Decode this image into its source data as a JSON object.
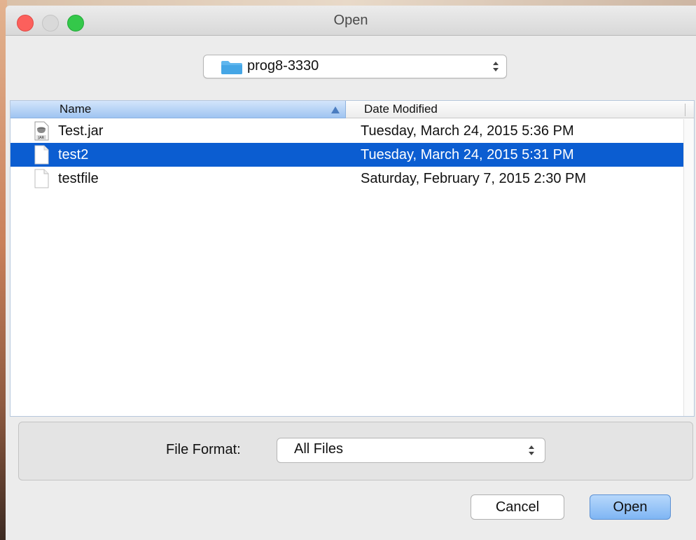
{
  "window": {
    "title": "Open"
  },
  "location": {
    "folder": "prog8-3330"
  },
  "file_list": {
    "columns": {
      "name": "Name",
      "date": "Date Modified"
    },
    "rows": [
      {
        "name": "Test.jar",
        "date": "Tuesday, March 24, 2015 5:36 PM",
        "icon": "jar-file-icon",
        "selected": false
      },
      {
        "name": "test2",
        "date": "Tuesday, March 24, 2015 5:31 PM",
        "icon": "document-icon",
        "selected": true
      },
      {
        "name": "testfile",
        "date": "Saturday, February 7, 2015 2:30 PM",
        "icon": "document-icon",
        "selected": false
      }
    ]
  },
  "format": {
    "label": "File Format:",
    "value": "All Files"
  },
  "buttons": {
    "cancel": "Cancel",
    "open": "Open"
  },
  "colors": {
    "selection": "#0b5dd1",
    "accent": "#7fb6f4",
    "close": "#fc605c",
    "maximize": "#34c84a"
  }
}
